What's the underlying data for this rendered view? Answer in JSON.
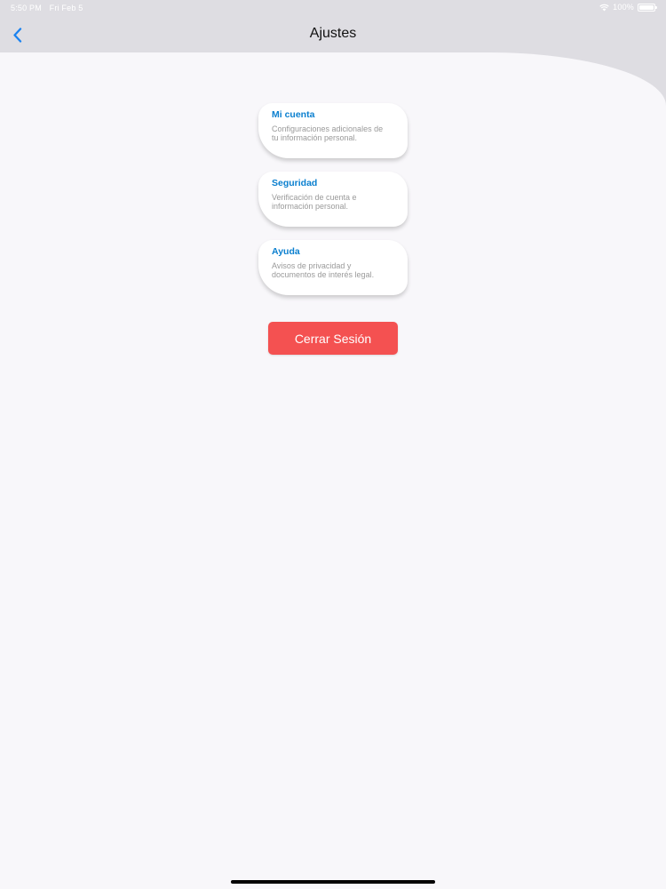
{
  "status_bar": {
    "time": "5:50 PM",
    "date": "Fri Feb 5",
    "battery": "100%",
    "wifi_icon": "wifi-icon",
    "battery_icon": "battery-icon"
  },
  "nav": {
    "title": "Ajustes",
    "back_icon": "chevron-left-icon"
  },
  "colors": {
    "accent": "#0a7fcf",
    "back": "#1a82f0",
    "logout": "#f45151",
    "nav_bg": "#dedde2",
    "content_bg": "#f8f7fa"
  },
  "cards": [
    {
      "title": "Mi cuenta",
      "description": "Configuraciones adicionales de tu información personal."
    },
    {
      "title": "Seguridad",
      "description": "Verificación de cuenta e información personal."
    },
    {
      "title": "Ayuda",
      "description": "Avisos de privacidad y documentos de interés legal."
    }
  ],
  "logout": {
    "label": "Cerrar Sesión"
  }
}
